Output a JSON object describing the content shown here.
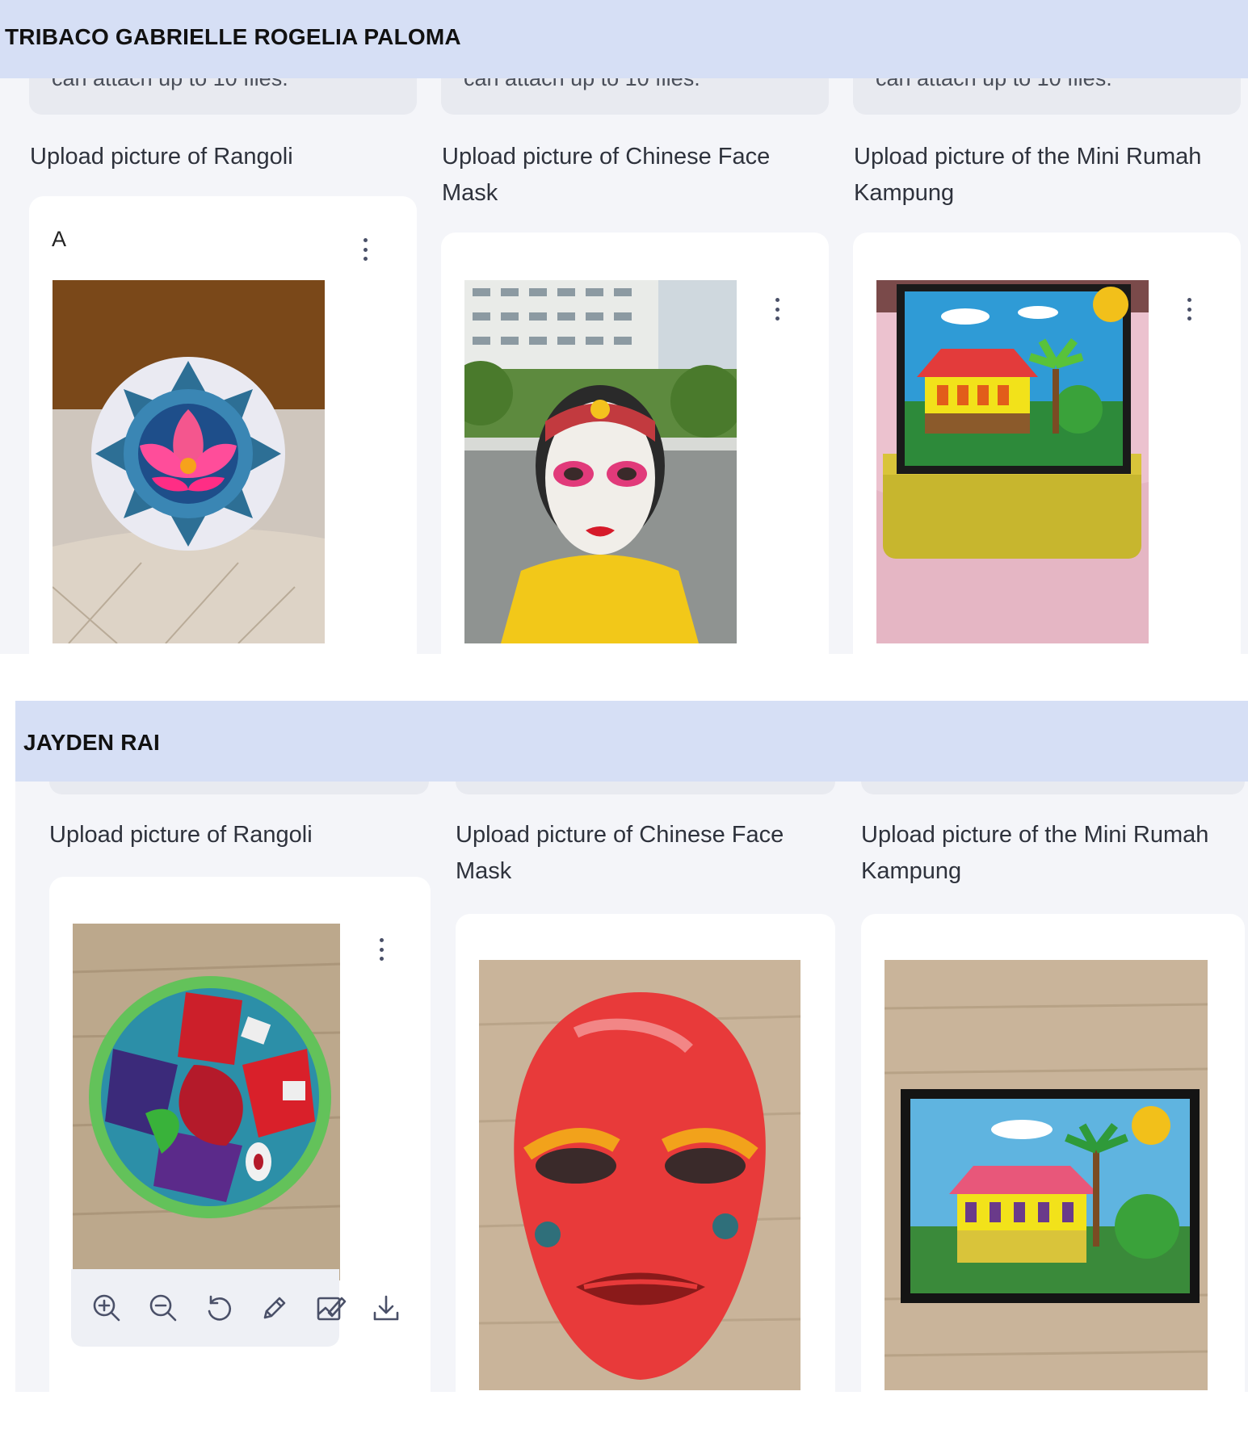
{
  "students": [
    {
      "name": "TRIBACO GABRIELLE ROGELIA PALOMA",
      "attach_note": "can attach up to 10 files.",
      "questions": [
        {
          "label": "Upload picture of Rangoli",
          "card_title": "A",
          "image": "lotus-rangoli-photo"
        },
        {
          "label": "Upload picture of  Chinese Face Mask",
          "card_title": "",
          "image": "child-wearing-face-mask-photo"
        },
        {
          "label": "Upload picture of the Mini Rumah Kampung",
          "card_title": "",
          "image": "framed-rumah-kampung-photo"
        }
      ]
    },
    {
      "name": "JAYDEN RAI",
      "attach_note": "",
      "questions": [
        {
          "label": "Upload picture of Rangoli",
          "card_title": "",
          "image": "sand-rangoli-photo"
        },
        {
          "label": "Upload picture of  Chinese Face Mask",
          "card_title": "",
          "image": "red-painted-mask-photo"
        },
        {
          "label": "Upload picture of the Mini Rumah Kampung",
          "card_title": "",
          "image": "framed-rumah-kampung-photo-2"
        }
      ]
    }
  ],
  "image_toolbar": {
    "tools": [
      "zoom-in-icon",
      "zoom-out-icon",
      "rotate-icon",
      "pen-icon",
      "edit-image-icon",
      "download-icon"
    ]
  },
  "colors": {
    "header": "#d6dff5",
    "panel": "#f4f5f9",
    "card": "#ffffff",
    "note": "#e8eaf0"
  }
}
